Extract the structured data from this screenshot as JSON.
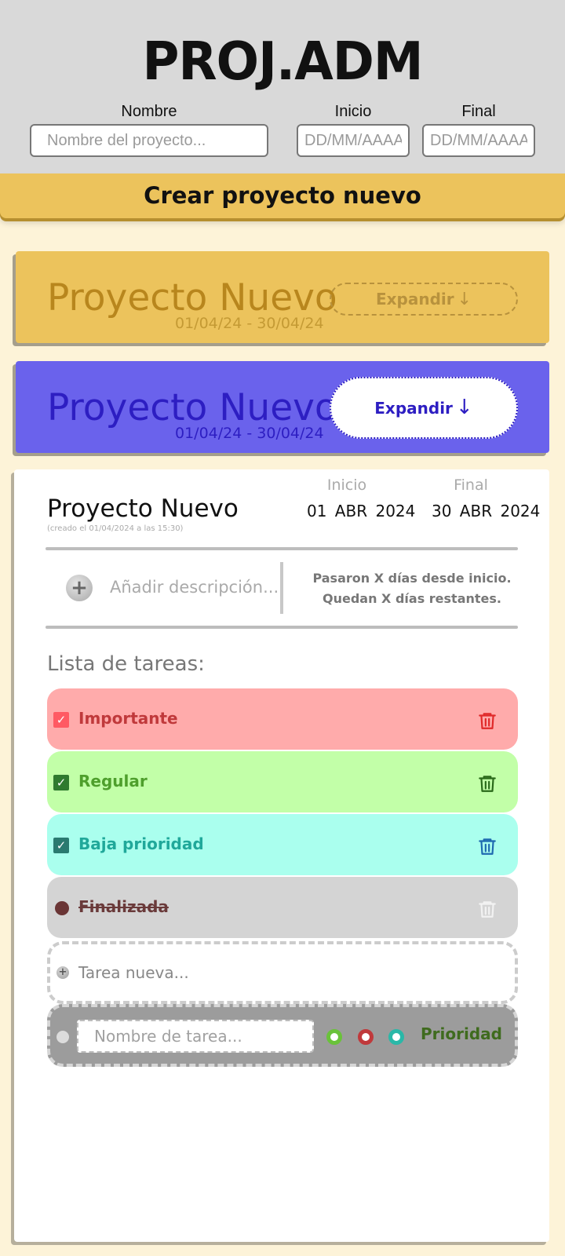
{
  "header": {
    "logo": "PROJ.ADM",
    "name_label": "Nombre",
    "name_placeholder": "Nombre del proyecto...",
    "start_label": "Inicio",
    "start_placeholder": "DD/MM/AAAA",
    "end_label": "Final",
    "end_placeholder": "DD/MM/AAAA",
    "create_button": "Crear proyecto nuevo"
  },
  "cards": [
    {
      "title": "Proyecto Nuevo",
      "dates": "01/04/24  -  30/04/24",
      "expand_label": "Expandir",
      "arrow": "↓"
    },
    {
      "title": "Proyecto Nuevo",
      "dates": "01/04/24  -  30/04/24",
      "expand_label": "Expandir",
      "arrow": "↓"
    }
  ],
  "panel": {
    "title": "Proyecto Nuevo",
    "created": "(creado el 01/04/2024 a las 15:30)",
    "start_label": "Inicio",
    "start_date": "01  ABR  2024",
    "end_label": "Final",
    "end_date": "30  ABR  2024",
    "add_description": "Añadir descripción...",
    "days_passed": "Pasaron X días desde inicio.",
    "days_left": "Quedan X días restantes.",
    "tasks_heading": "Lista de tareas:",
    "tasks": [
      {
        "label": "Importante",
        "bg": "#ffabab",
        "color": "#c0393b",
        "check": "#ff5a63",
        "trash": "#e02a2a"
      },
      {
        "label": "Regular",
        "bg": "#c2ffa8",
        "color": "#4e9f2c",
        "check": "#2f7a2f",
        "trash": "#2a6a1a"
      },
      {
        "label": "Baja prioridad",
        "bg": "#aaffee",
        "color": "#20a89a",
        "check": "#2a7a70",
        "trash": "#1e6ab0"
      },
      {
        "label": "Finalizada",
        "bg": "#d4d4d4",
        "color": "#6a3a3a",
        "dot": "#6a3535",
        "trash": "#f2f2f2"
      }
    ],
    "new_task": "Tarea nueva...",
    "form": {
      "name_placeholder": "Nombre de tarea...",
      "priority_label": "Prioridad",
      "priority_colors": [
        "#6ac23a",
        "#c0393b",
        "#2ab8a8"
      ]
    }
  }
}
